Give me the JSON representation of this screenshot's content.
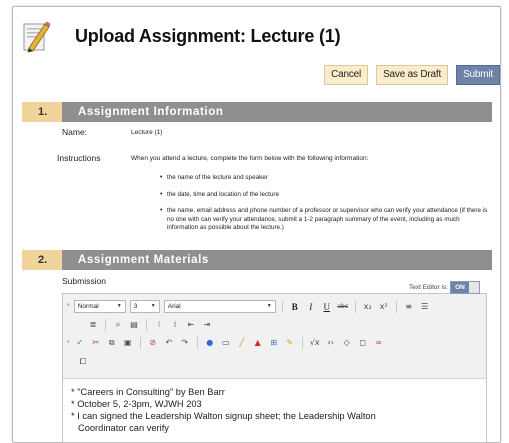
{
  "header": {
    "title": "Upload Assignment: Lecture (1)",
    "icon": "assignment-pencil-icon"
  },
  "actions": {
    "cancel": "Cancel",
    "save_draft": "Save as Draft",
    "submit": "Submit"
  },
  "section1": {
    "number": "1.",
    "title": "Assignment Information",
    "name_label": "Name:",
    "name_value": "Lecture (1)",
    "instructions_label": "Instructions",
    "instructions_text": "When you attend a lecture, complete the form below with the following information:",
    "bullets": [
      "the name of the lecture and speaker",
      "the date, time and location of the lecture",
      "the name, email address and phone number of a professor or supervisor who can verify your attendance (if there is no one with can verify your attendance, submit a 1-2 paragraph summary of the event, including as much information as possible about the lecture.)"
    ]
  },
  "section2": {
    "number": "2.",
    "title": "Assignment Materials",
    "submission_label": "Submission",
    "text_editor_label": "Text Editor is:",
    "text_editor_state": "ON",
    "toolbar": {
      "format": "Normal",
      "size": "3",
      "font": "Arial"
    },
    "content": [
      "* \"Careers in Consulting\" by Ben Barr",
      "* October 5, 2-3pm, WJWH 203",
      "* I can signed the Leadership Walton signup sheet; the Leadership Walton",
      "Coordinator can verify"
    ]
  }
}
